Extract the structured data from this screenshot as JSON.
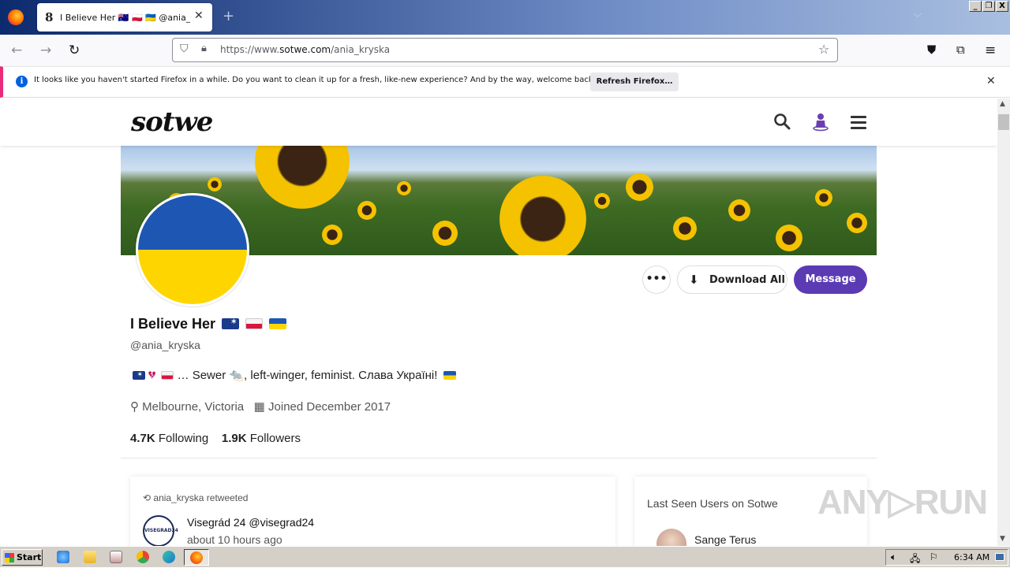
{
  "browser": {
    "tab_title": "I Believe Her 🇦🇺 🇵🇱 🇺🇦 @ania_kryska",
    "tab_favicon": "8",
    "new_tab_symbol": "+",
    "url_prefix": "https://www.",
    "url_domain": "sotwe.com",
    "url_path": "/ania_kryska",
    "window_buttons": [
      "_",
      "❐",
      "X"
    ]
  },
  "notification": {
    "text": "It looks like you haven't started Firefox in a while. Do you want to clean it up for a fresh, like-new experience? And by the way, welcome back!",
    "button_label": "Refresh Firefox…",
    "info_symbol": "i"
  },
  "site": {
    "logo": "sotwe",
    "icons": [
      "search-icon",
      "user-icon",
      "menu-icon"
    ]
  },
  "profile": {
    "name": "I Believe Her",
    "handle": "@ania_kryska",
    "bio_text": "… Sewer 🐀, left-winger, feminist. Слава Україні!",
    "location": "Melbourne, Victoria",
    "joined": "Joined December 2017",
    "following_count": "4.7K",
    "following_label": "Following",
    "followers_count": "1.9K",
    "followers_label": "Followers",
    "more_label": "•••",
    "download_label": "Download All",
    "message_label": "Message"
  },
  "tweet": {
    "retweet_line": "ania_kryska retweeted",
    "author": "Visegrád 24 @visegrad24",
    "time": "about 10 hours ago",
    "avatar_text": "VISEGRAD24"
  },
  "sidebar": {
    "title": "Last Seen Users on Sotwe",
    "users": [
      "Sange Terus"
    ]
  },
  "watermark": "ANY▷RUN",
  "taskbar": {
    "start_label": "Start",
    "clock": "6:34 AM"
  },
  "colors": {
    "accent": "#5b3bb3",
    "notification_stripe": "#e92b7a",
    "ukraine_blue": "#1d57b3",
    "ukraine_yellow": "#ffd500"
  }
}
